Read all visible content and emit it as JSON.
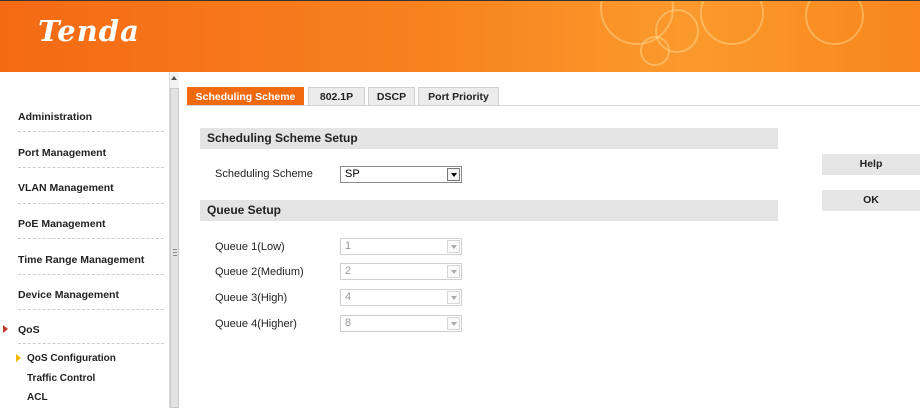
{
  "header": {
    "logo": "Tenda"
  },
  "sidebar": {
    "items": [
      {
        "label": "Administration"
      },
      {
        "label": "Port Management"
      },
      {
        "label": "VLAN Management"
      },
      {
        "label": "PoE Management"
      },
      {
        "label": "Time Range Management"
      },
      {
        "label": "Device Management"
      },
      {
        "label": "QoS"
      }
    ],
    "subitems": [
      {
        "label": "QoS Configuration"
      },
      {
        "label": "Traffic Control"
      },
      {
        "label": "ACL"
      }
    ]
  },
  "tabs": [
    {
      "label": "Scheduling Scheme",
      "active": true
    },
    {
      "label": "802.1P"
    },
    {
      "label": "DSCP"
    },
    {
      "label": "Port Priority"
    }
  ],
  "scheduling": {
    "section_title": "Scheduling Scheme Setup",
    "label": "Scheduling Scheme",
    "value": "SP"
  },
  "queue": {
    "section_title": "Queue Setup",
    "rows": [
      {
        "label": "Queue 1(Low)",
        "value": "1"
      },
      {
        "label": "Queue 2(Medium)",
        "value": "2"
      },
      {
        "label": "Queue 3(High)",
        "value": "4"
      },
      {
        "label": "Queue 4(Higher)",
        "value": "8"
      }
    ]
  },
  "buttons": {
    "help": "Help",
    "ok": "OK"
  },
  "colors": {
    "accent": "#f26a10",
    "header": "#f7811e",
    "section_bar": "#e4e4e4"
  }
}
